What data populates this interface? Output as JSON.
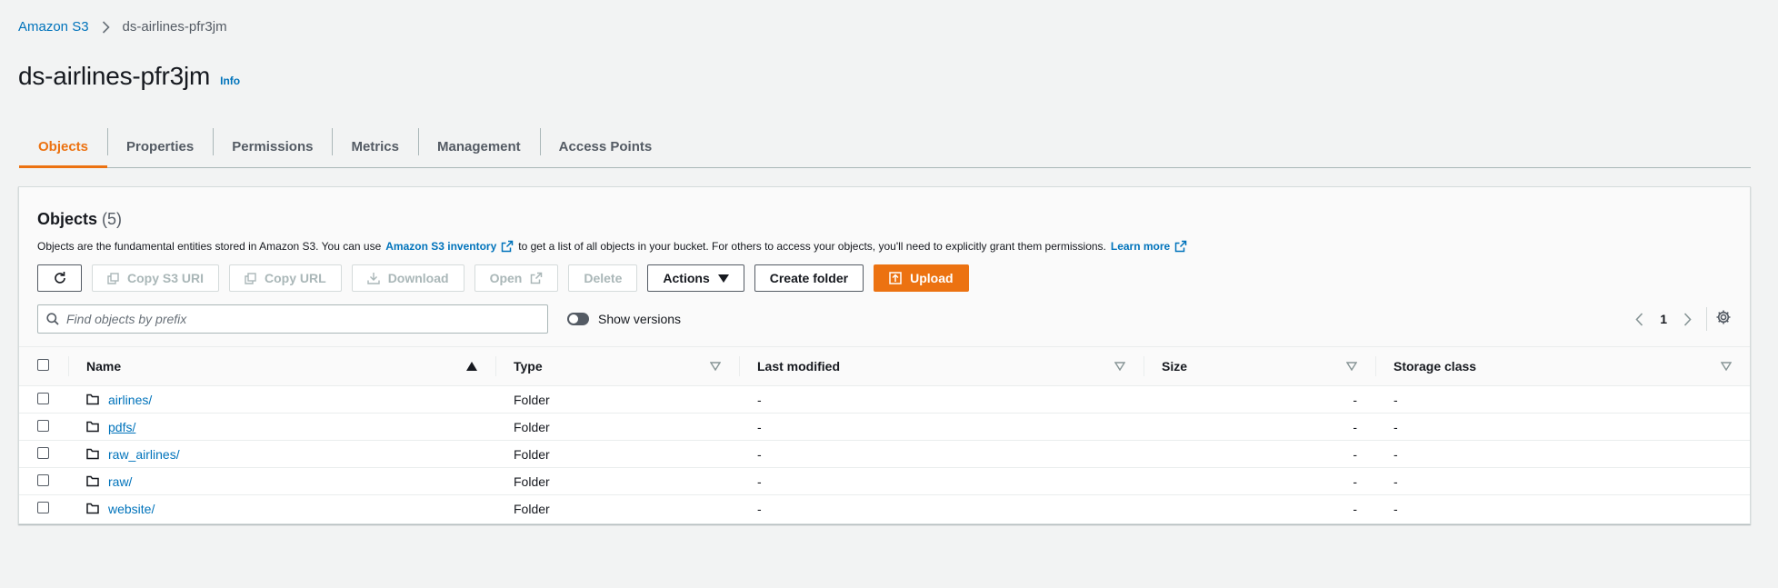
{
  "breadcrumb": {
    "root": "Amazon S3",
    "current": "ds-airlines-pfr3jm"
  },
  "page": {
    "title": "ds-airlines-pfr3jm",
    "info": "Info"
  },
  "tabs": [
    {
      "label": "Objects",
      "active": true
    },
    {
      "label": "Properties",
      "active": false
    },
    {
      "label": "Permissions",
      "active": false
    },
    {
      "label": "Metrics",
      "active": false
    },
    {
      "label": "Management",
      "active": false
    },
    {
      "label": "Access Points",
      "active": false
    }
  ],
  "objects": {
    "title": "Objects",
    "count": "(5)",
    "desc_part1": "Objects are the fundamental entities stored in Amazon S3. You can use",
    "inventory_link": "Amazon S3 inventory",
    "desc_part2": "to get a list of all objects in your bucket. For others to access your objects, you'll need to explicitly grant them permissions.",
    "learn_more": "Learn more"
  },
  "toolbar": {
    "copy_s3_uri": "Copy S3 URI",
    "copy_url": "Copy URL",
    "download": "Download",
    "open": "Open",
    "delete": "Delete",
    "actions": "Actions",
    "create_folder": "Create folder",
    "upload": "Upload"
  },
  "search": {
    "placeholder": "Find objects by prefix"
  },
  "toggle": {
    "label": "Show versions",
    "on": false
  },
  "pagination": {
    "page": "1"
  },
  "table": {
    "columns": [
      "Name",
      "Type",
      "Last modified",
      "Size",
      "Storage class"
    ],
    "rows": [
      {
        "name": "airlines/",
        "type": "Folder",
        "last_modified": "-",
        "size": "-",
        "storage_class": "-"
      },
      {
        "name": "pdfs/",
        "type": "Folder",
        "last_modified": "-",
        "size": "-",
        "storage_class": "-"
      },
      {
        "name": "raw_airlines/",
        "type": "Folder",
        "last_modified": "-",
        "size": "-",
        "storage_class": "-"
      },
      {
        "name": "raw/",
        "type": "Folder",
        "last_modified": "-",
        "size": "-",
        "storage_class": "-"
      },
      {
        "name": "website/",
        "type": "Folder",
        "last_modified": "-",
        "size": "-",
        "storage_class": "-"
      }
    ]
  },
  "colors": {
    "link": "#0073bb",
    "accent": "#ec7211",
    "text": "#16191f",
    "muted": "#545b64",
    "background": "#f2f3f3"
  }
}
